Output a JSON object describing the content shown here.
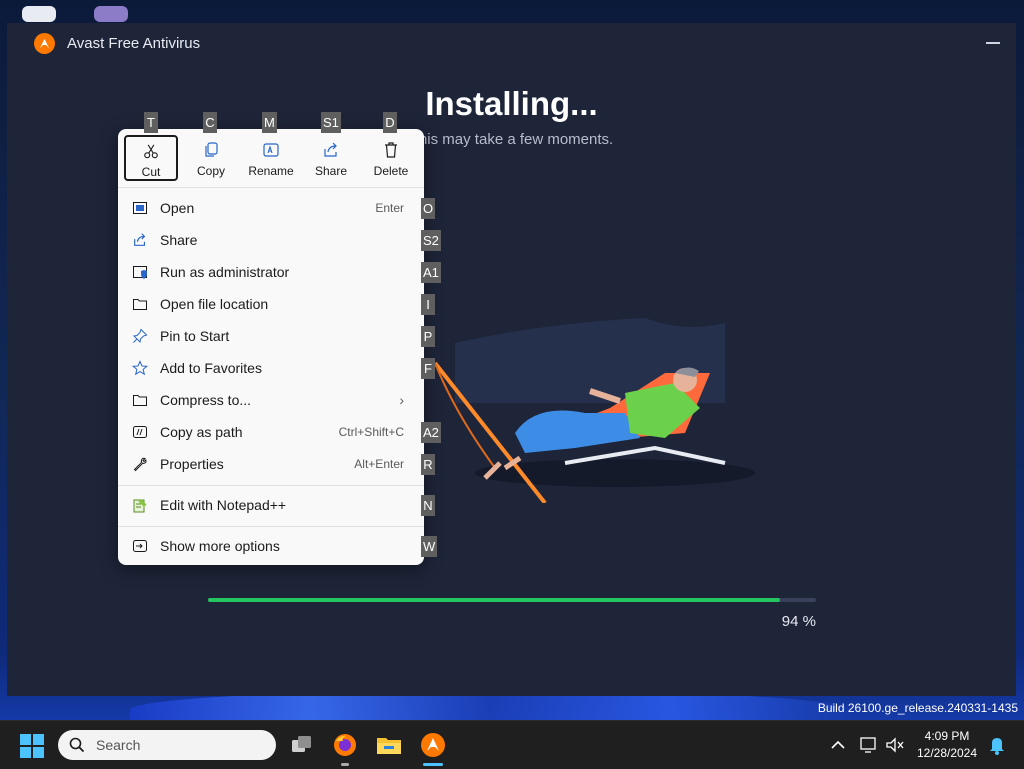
{
  "window": {
    "title": "Avast Free Antivirus",
    "heading": "Installing...",
    "subheading": "This may take a few moments.",
    "progress_percent": 94,
    "progress_label": "94 %"
  },
  "context_menu": {
    "quick_actions": [
      {
        "label": "Cut",
        "key": "T",
        "icon": "cut-icon"
      },
      {
        "label": "Copy",
        "key": "C",
        "icon": "copy-icon"
      },
      {
        "label": "Rename",
        "key": "M",
        "icon": "rename-icon"
      },
      {
        "label": "Share",
        "key": "S1",
        "icon": "share-icon"
      },
      {
        "label": "Delete",
        "key": "D",
        "icon": "delete-icon"
      }
    ],
    "items": [
      {
        "label": "Open",
        "shortcut": "Enter",
        "key": "O",
        "icon": "open-icon"
      },
      {
        "label": "Share",
        "shortcut": "",
        "key": "S2",
        "icon": "share-icon"
      },
      {
        "label": "Run as administrator",
        "shortcut": "",
        "key": "A1",
        "icon": "shield-icon"
      },
      {
        "label": "Open file location",
        "shortcut": "",
        "key": "I",
        "icon": "folder-icon"
      },
      {
        "label": "Pin to Start",
        "shortcut": "",
        "key": "P",
        "icon": "pin-icon"
      },
      {
        "label": "Add to Favorites",
        "shortcut": "",
        "key": "F",
        "icon": "star-icon"
      },
      {
        "label": "Compress to...",
        "shortcut": "",
        "key": "",
        "icon": "archive-icon",
        "submenu": true
      },
      {
        "label": "Copy as path",
        "shortcut": "Ctrl+Shift+C",
        "key": "A2",
        "icon": "path-icon"
      },
      {
        "label": "Properties",
        "shortcut": "Alt+Enter",
        "key": "R",
        "icon": "wrench-icon"
      },
      {
        "label": "Edit with Notepad++",
        "shortcut": "",
        "key": "N",
        "icon": "notepad-icon"
      },
      {
        "label": "Show more options",
        "shortcut": "",
        "key": "W",
        "icon": "more-options-icon"
      }
    ]
  },
  "taskbar": {
    "search_placeholder": "Search",
    "time": "4:09 PM",
    "date": "12/28/2024",
    "build_text": "Build 26100.ge_release.240331-1435"
  },
  "colors": {
    "accent_orange": "#ff7800",
    "progress_green": "#22c55e",
    "window_bg": "#1e2539"
  }
}
